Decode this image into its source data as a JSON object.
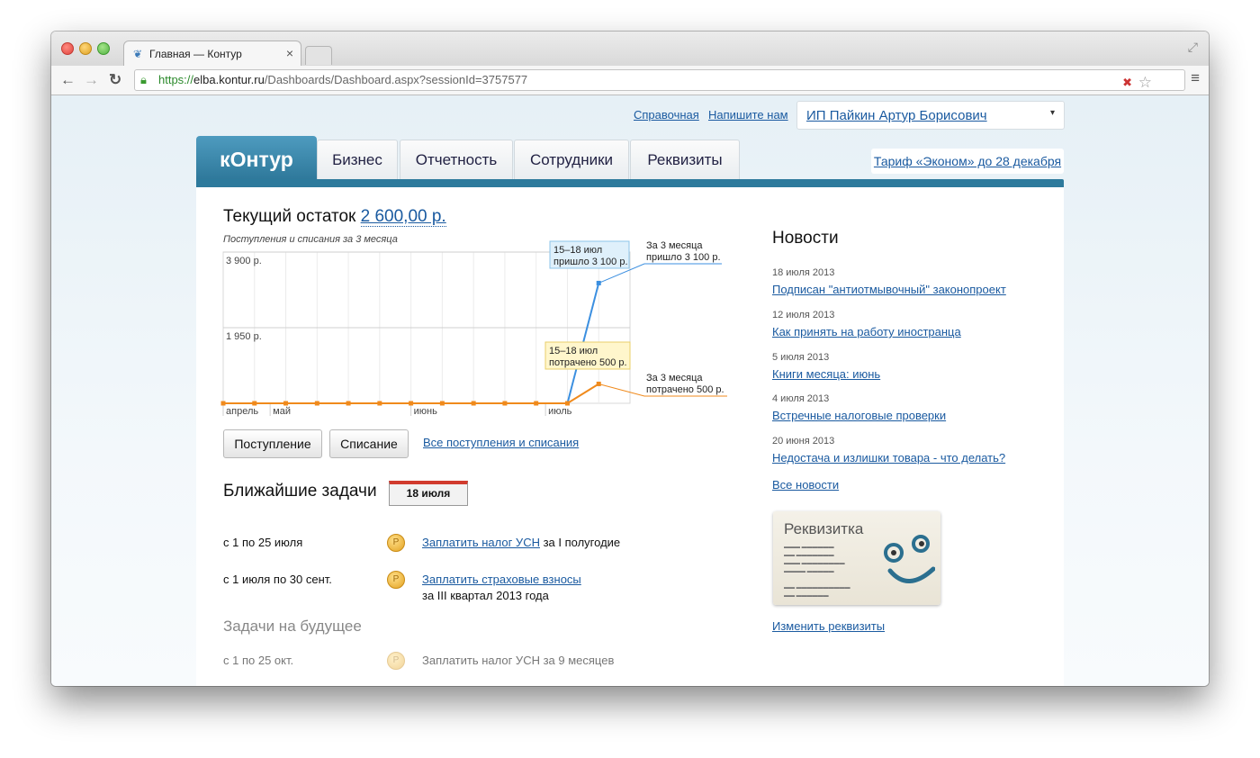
{
  "browser": {
    "tab_title": "Главная — Контур",
    "tab_close": "×",
    "url_scheme": "https://",
    "url_host": "elba.kontur.ru",
    "url_path": "/Dashboards/Dashboard.aspx?sessionId=3757577",
    "icons": [
      "back-arrow",
      "forward-arrow",
      "reload",
      "lock",
      "blocked-popup",
      "star",
      "menu"
    ]
  },
  "header": {
    "help_link": "Справочная",
    "contact_link": "Напишите нам",
    "user_name": "ИП Пайкин Артур Борисович",
    "user_caret": "▾"
  },
  "nav": {
    "logo": "кОнтур",
    "tabs": [
      {
        "label": "Бизнес"
      },
      {
        "label": "Отчетность"
      },
      {
        "label": "Сотрудники"
      },
      {
        "label": "Реквизиты"
      }
    ],
    "tariff_link": "Тариф «Эконом» до 28 декабря",
    "accent_color": "#2d7a9c"
  },
  "balance": {
    "label": "Текущий остаток",
    "value": "2 600,00 р.",
    "chart_subtitle": "Поступления и списания за 3 месяца"
  },
  "chart_data": {
    "type": "line",
    "y_tick_labels": [
      "3 900 р.",
      "1 950 р."
    ],
    "ylim": [
      0,
      3900
    ],
    "x_tick_labels": [
      "апрель",
      "май",
      "июнь",
      "июль"
    ],
    "series": [
      {
        "name": "поступления",
        "color": "#3b8fe0",
        "values": [
          0,
          0,
          0,
          0,
          0,
          0,
          0,
          0,
          0,
          0,
          0,
          0,
          3100
        ]
      },
      {
        "name": "списания",
        "color": "#f08a1c",
        "values": [
          0,
          0,
          0,
          0,
          0,
          0,
          0,
          0,
          0,
          0,
          0,
          0,
          500
        ]
      }
    ],
    "annotations": {
      "income_period_line1": "15–18 июл",
      "income_period_line2": "пришло 3 100 р.",
      "income_total_line1": "За 3 месяца",
      "income_total_line2": "пришло 3 100 р.",
      "expense_period_line1": "15–18 июл",
      "expense_period_line2": "потрачено 500 р.",
      "expense_total_line1": "За 3 месяца",
      "expense_total_line2": "потрачено 500 р."
    }
  },
  "buttons": {
    "income": "Поступление",
    "expense": "Списание",
    "all_link": "Все поступления и списания"
  },
  "tasks": {
    "title": "Ближайшие задачи",
    "calendar_date": "18 июля",
    "coin_symbol": "Р",
    "items": [
      {
        "date": "с 1 по 25 июля",
        "link": "Заплатить налог УСН",
        "rest": " за I полугодие",
        "rest2": ""
      },
      {
        "date": "с 1 июля по 30 сент.",
        "link": "Заплатить страховые взносы",
        "rest": "",
        "rest2": "за III квартал 2013 года"
      }
    ],
    "future_title": "Задачи на будущее",
    "future": {
      "date": "с 1 по 25 окт.",
      "text": "Заплатить налог УСН за 9 месяцев"
    }
  },
  "news": {
    "title": "Новости",
    "items": [
      {
        "date": "18 июля 2013",
        "title": "Подписан \"антиотмывочный\" законопроект"
      },
      {
        "date": "12 июля 2013",
        "title": "Как принять на работу иностранца"
      },
      {
        "date": "5 июля 2013",
        "title": "Книги месяца: июнь"
      },
      {
        "date": "4 июля 2013",
        "title": "Встречные налоговые проверки"
      },
      {
        "date": "20 июня 2013",
        "title": "Недостача и излишки товара - что делать?"
      }
    ],
    "all_link": "Все новости"
  },
  "card": {
    "title": "Реквизитка",
    "edit_link": "Изменить реквизиты"
  }
}
